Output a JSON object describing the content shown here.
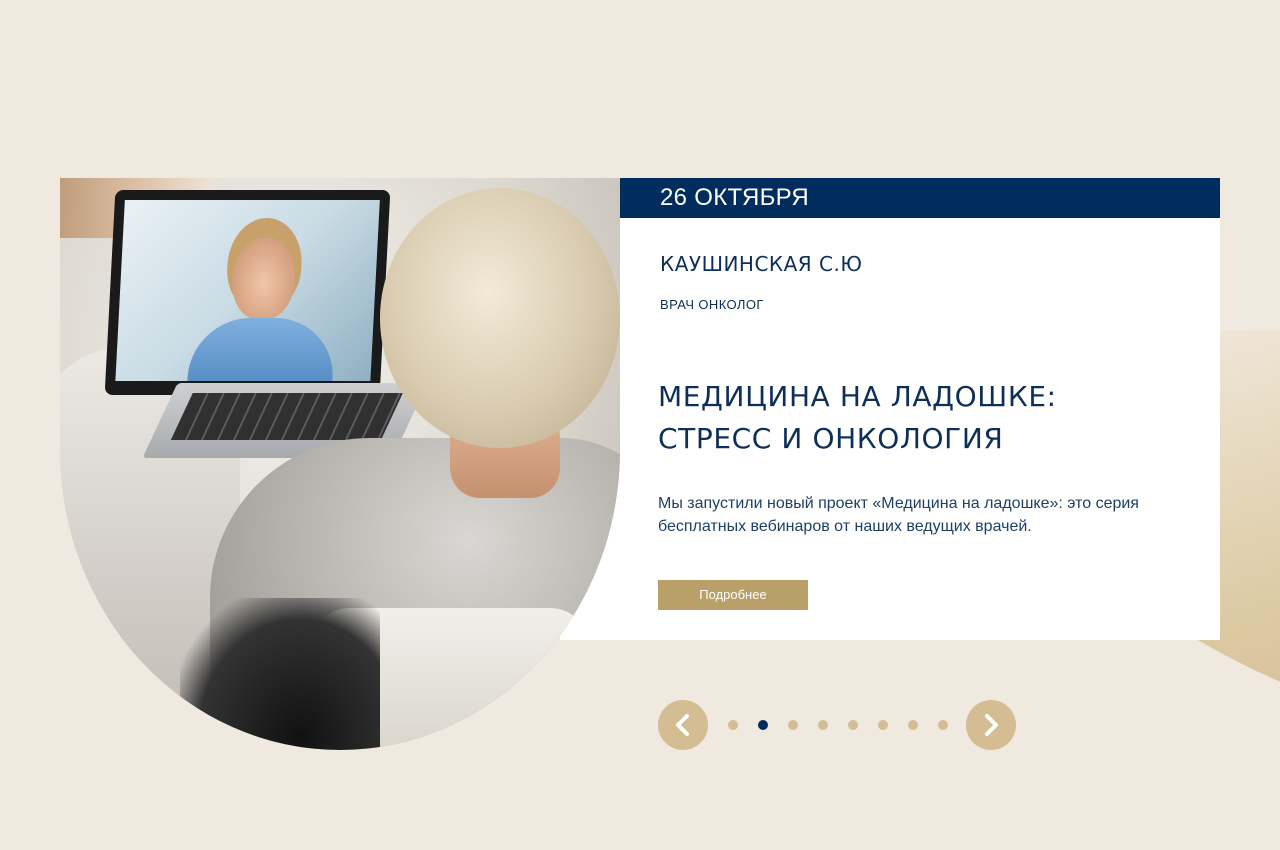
{
  "slide": {
    "date": "26 ОКТЯБРЯ",
    "doctor_name": "КАУШИНСКАЯ С.Ю",
    "doctor_role": "ВРАЧ ОНКОЛОГ",
    "title_line1": "МЕДИЦИНА НА ЛАДОШКЕ:",
    "title_line2": "СТРЕСС И ОНКОЛОГИЯ",
    "description_line1": "Мы запустили новый проект «Медицина на ладошке»: это серия",
    "description_line2": "бесплатных вебинаров от наших ведущих врачей.",
    "more_button": "Подробнее"
  },
  "carousel": {
    "dots_count": 8,
    "active_index": 1,
    "prev_icon": "chevron-left-icon",
    "next_icon": "chevron-right-icon"
  },
  "colors": {
    "background": "#f0e9e0",
    "navy": "#002d5d",
    "gold": "#b9a068",
    "gold_light": "#d4bd93",
    "text": "#0d2f5a"
  }
}
